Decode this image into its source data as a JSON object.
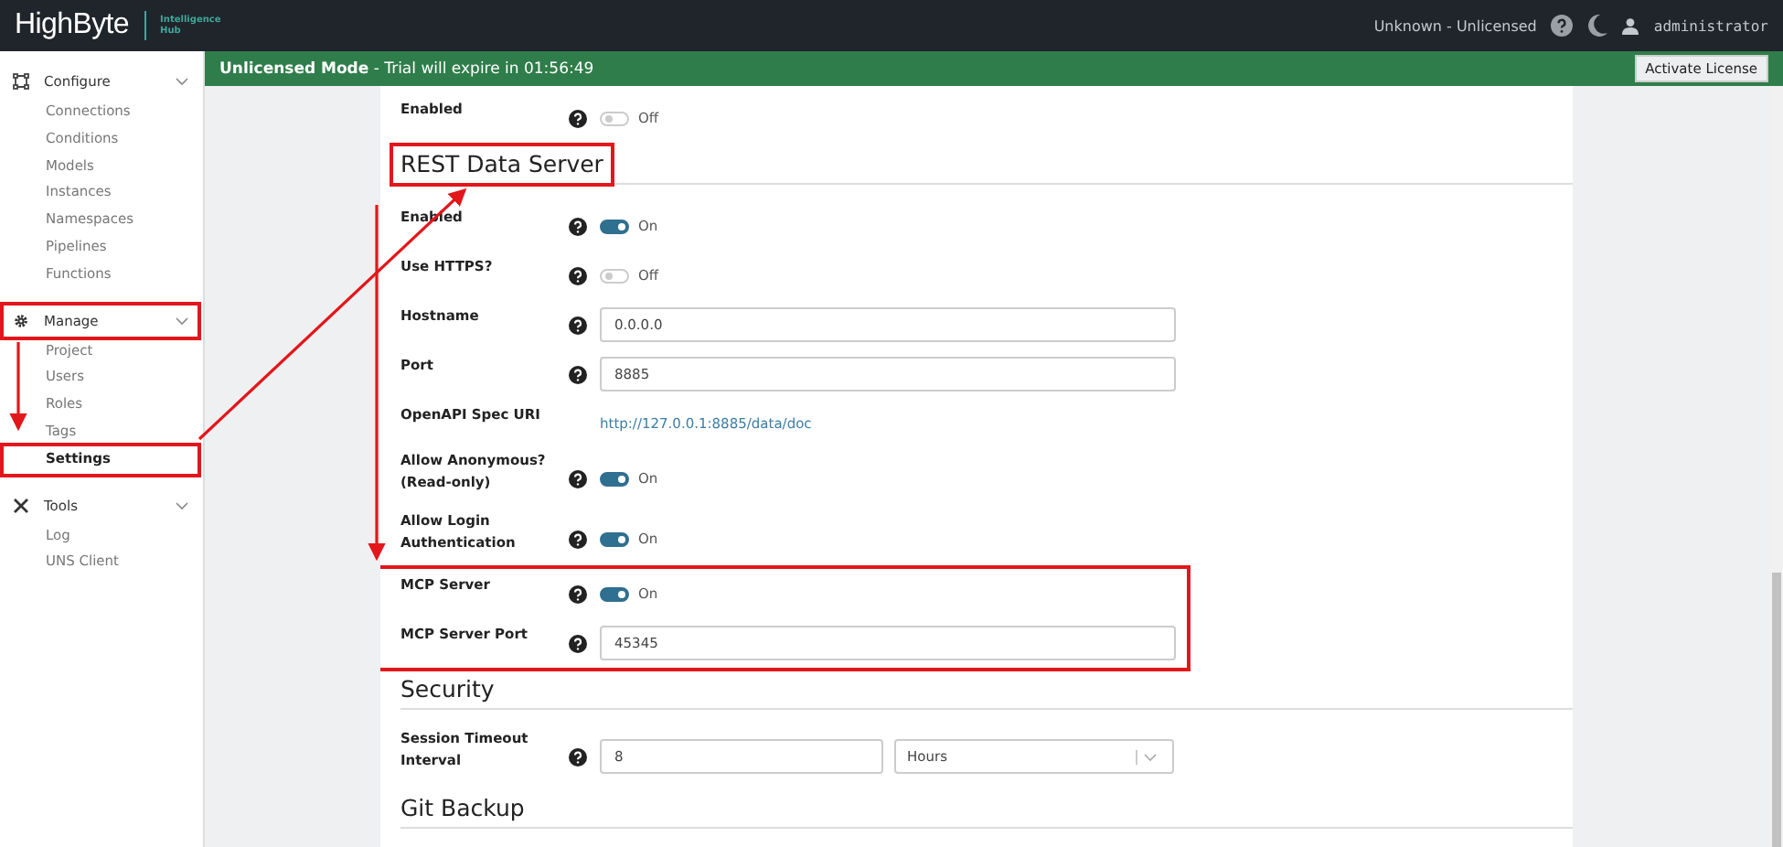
{
  "header": {
    "logo": "HighByte",
    "product": "Intelligence Hub",
    "license_status": "Unknown - Unlicensed",
    "user": "administrator"
  },
  "sidebar": {
    "groups": [
      {
        "label": "Configure",
        "expanded": true,
        "highlighted": false,
        "items": [
          {
            "label": "Connections",
            "selected": false,
            "highlighted": false
          },
          {
            "label": "Conditions",
            "selected": false,
            "highlighted": false
          },
          {
            "label": "Models",
            "selected": false,
            "highlighted": false
          },
          {
            "label": "Instances",
            "selected": false,
            "highlighted": false
          },
          {
            "label": "Namespaces",
            "selected": false,
            "highlighted": false
          },
          {
            "label": "Pipelines",
            "selected": false,
            "highlighted": false
          },
          {
            "label": "Functions",
            "selected": false,
            "highlighted": false
          }
        ]
      },
      {
        "label": "Manage",
        "expanded": true,
        "highlighted": true,
        "items": [
          {
            "label": "Project",
            "selected": false,
            "highlighted": false
          },
          {
            "label": "Users",
            "selected": false,
            "highlighted": false
          },
          {
            "label": "Roles",
            "selected": false,
            "highlighted": false
          },
          {
            "label": "Tags",
            "selected": false,
            "highlighted": false
          },
          {
            "label": "Settings",
            "selected": true,
            "highlighted": true
          }
        ]
      },
      {
        "label": "Tools",
        "expanded": true,
        "highlighted": false,
        "items": [
          {
            "label": "Log",
            "selected": false,
            "highlighted": false
          },
          {
            "label": "UNS Client",
            "selected": false,
            "highlighted": false
          }
        ]
      }
    ]
  },
  "banner": {
    "title": "Unlicensed Mode",
    "message": " - Trial will expire in 01:56:49",
    "button": "Activate License"
  },
  "sections": [
    {
      "rows": [
        {
          "kind": "toggle",
          "label": "Enabled",
          "on": false,
          "value": "Off",
          "highlighted": false
        }
      ]
    },
    {
      "heading": "REST Data Server",
      "highlighted": true,
      "rows": [
        {
          "kind": "toggle",
          "label": "Enabled",
          "on": true,
          "value": "On",
          "highlighted": false
        },
        {
          "kind": "toggle",
          "label": "Use HTTPS?",
          "on": false,
          "value": "Off",
          "highlighted": false
        },
        {
          "kind": "text",
          "label": "Hostname",
          "value": "0.0.0.0",
          "highlighted": false
        },
        {
          "kind": "text",
          "label": "Port",
          "value": "8885",
          "highlighted": false
        },
        {
          "kind": "link",
          "label": "OpenAPI Spec URI",
          "value": "http://127.0.0.1:8885/data/doc",
          "highlighted": false
        },
        {
          "kind": "toggle",
          "label": "Allow Anonymous? (Read-only)",
          "on": true,
          "value": "On",
          "highlighted": false
        },
        {
          "kind": "toggle",
          "label": "Allow Login Authentication",
          "on": true,
          "value": "On",
          "highlighted": false
        },
        {
          "kind": "toggle",
          "label": "MCP Server",
          "on": true,
          "value": "On",
          "highlighted": true
        },
        {
          "kind": "text",
          "label": "MCP Server Port",
          "value": "45345",
          "highlighted": true
        }
      ]
    },
    {
      "heading": "Security",
      "highlighted": false,
      "rows": [
        {
          "kind": "select",
          "label": "Session Timeout Interval",
          "value": "8",
          "unit": "Hours",
          "highlighted": false
        }
      ]
    },
    {
      "heading": "Git Backup",
      "highlighted": false
    }
  ]
}
